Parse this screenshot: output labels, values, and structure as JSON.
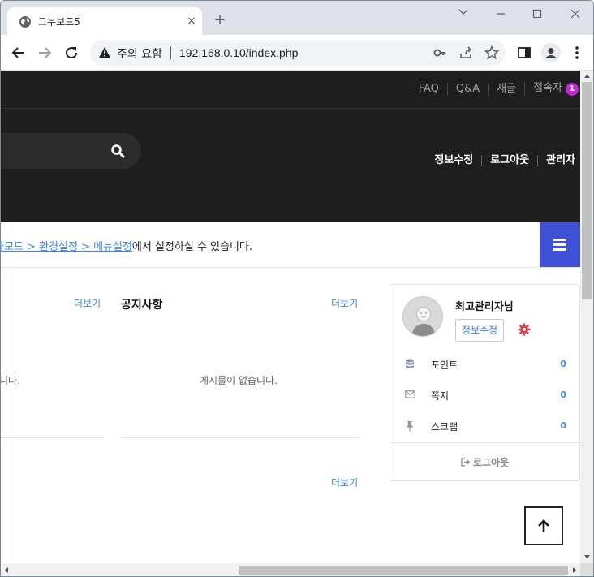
{
  "browser": {
    "tab_title": "그누보드5",
    "tab_close": "×",
    "new_tab": "+",
    "security_label": "주의 요함",
    "url": "192.168.0.10/index.php"
  },
  "header": {
    "top_links": [
      "FAQ",
      "Q&A",
      "새글"
    ],
    "visitor_label": "접속자",
    "visitor_count": "1",
    "member_links": [
      "정보수정",
      "로그아웃",
      "관리자"
    ]
  },
  "notice": {
    "link1": "라모드",
    "sep1": " > ",
    "link2": "환경설정",
    "sep2": " > ",
    "link3": "메뉴설정",
    "suffix": "에서 설정하실 수 있습니다."
  },
  "content": {
    "left_more": "더보기",
    "left_empty": "니다.",
    "notice_title": "공지사항",
    "notice_more": "더보기",
    "notice_empty": "게시물이 없습니다.",
    "bottom_more": "더보기"
  },
  "login_box": {
    "name": "최고관리자님",
    "edit_label": "정보수정",
    "rows": [
      {
        "label": "포인트",
        "value": "0",
        "icon": "database-icon"
      },
      {
        "label": "쪽지",
        "value": "0",
        "icon": "envelope-icon"
      },
      {
        "label": "스크랩",
        "value": "0",
        "icon": "thumbtack-icon"
      }
    ],
    "logout_label": "로그아웃"
  },
  "colors": {
    "header_bg": "#1e1e1f",
    "accent_blue": "#3f51d6",
    "link_blue": "#3b82f6",
    "badge_magenta": "#c026d3",
    "gear_red": "#e03a4a"
  }
}
